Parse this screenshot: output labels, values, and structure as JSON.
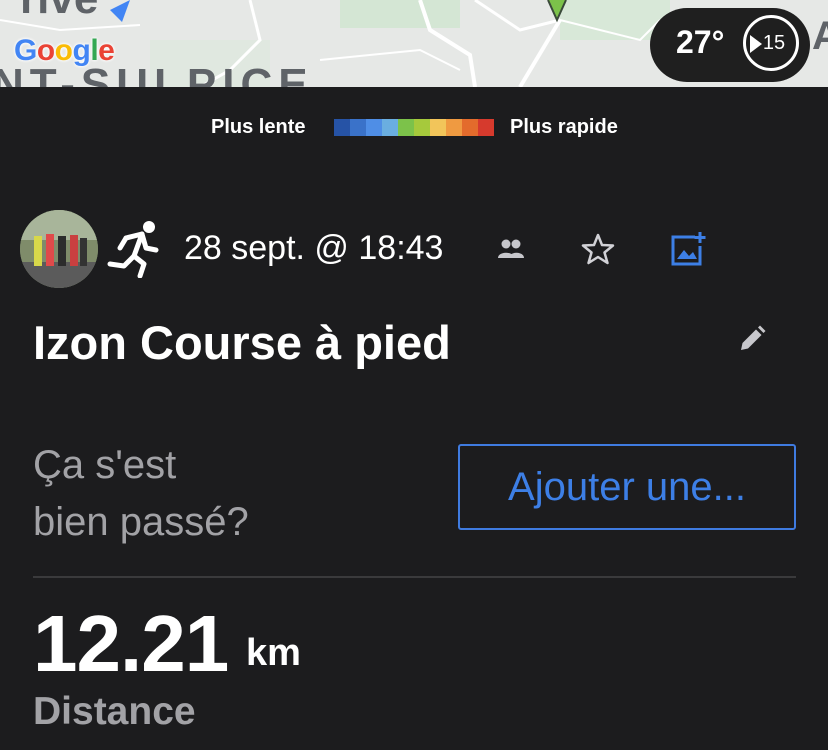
{
  "map": {
    "logo_text": "Google",
    "place_label": "NT-SULPICE",
    "place_label_top": "rive",
    "edge_letter": "A",
    "weather": {
      "temperature": "27°",
      "aqi": "15"
    }
  },
  "legend": {
    "slow_label": "Plus lente",
    "fast_label": "Plus rapide",
    "colors": [
      "#2653a6",
      "#3a72c9",
      "#4f8ee6",
      "#6aaee0",
      "#7cc24a",
      "#a6c93c",
      "#f2c55a",
      "#ef9a41",
      "#e36b2c",
      "#d63a2d"
    ]
  },
  "activity": {
    "avatar_alt": "avatar",
    "type_icon": "running-icon",
    "date": "28 sept. @ 18:43",
    "title": "Izon Course à pied",
    "question_line1": "Ça s'est",
    "question_line2": "bien passé?",
    "add_button_label": "Ajouter une..."
  },
  "stats": {
    "distance_value": "12.21",
    "distance_unit": "km",
    "distance_label": "Distance"
  },
  "colors": {
    "background": "#1c1c1e",
    "accent_blue": "#3d7fe6",
    "muted_text": "#a2a2a6"
  }
}
